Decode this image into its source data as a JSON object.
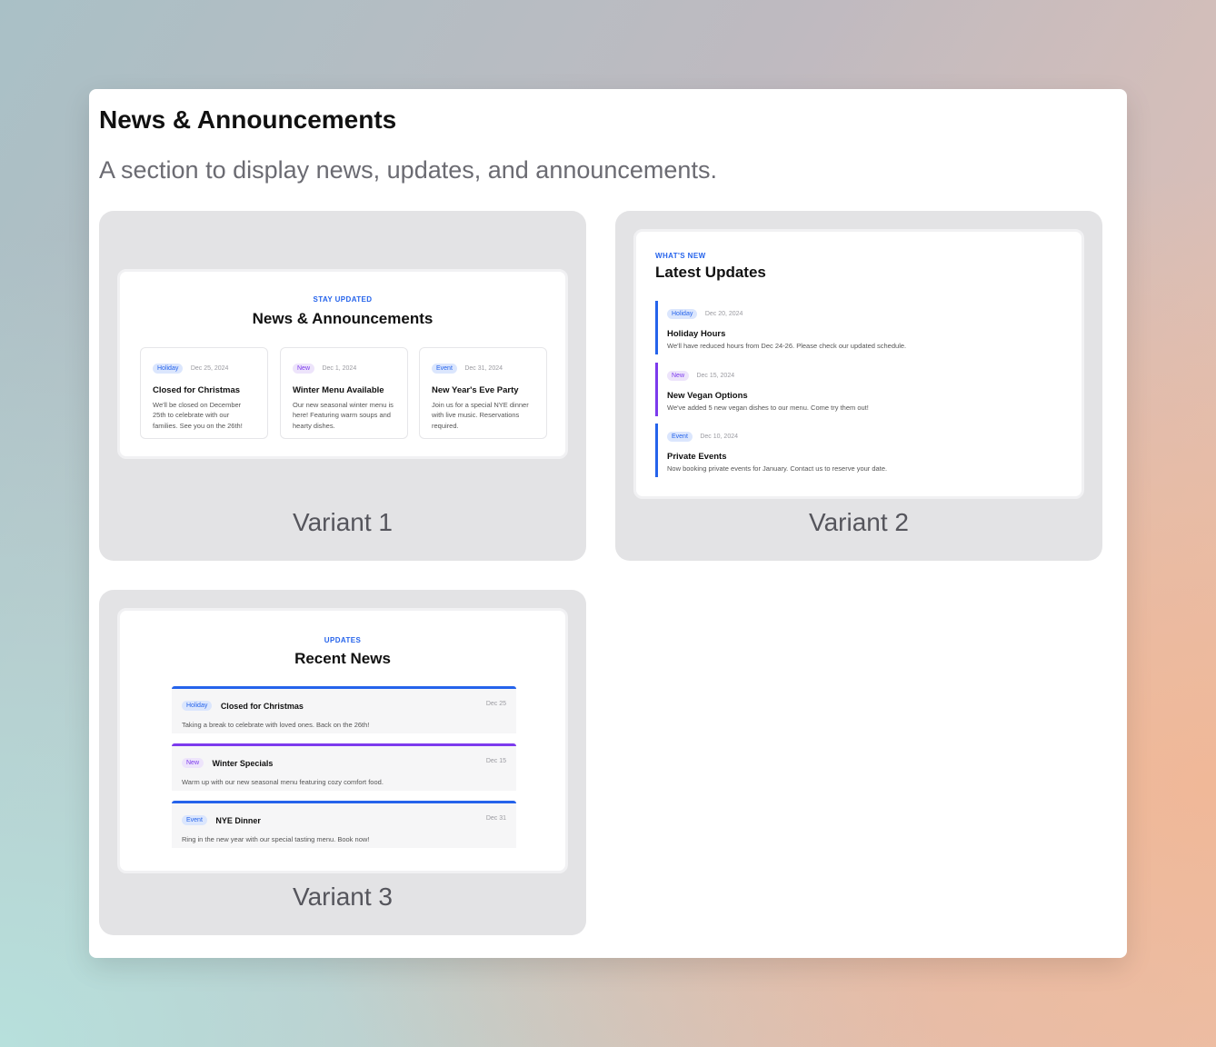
{
  "header": {
    "title": "News & Announcements",
    "description": "A section to display news, updates, and announcements."
  },
  "variants": [
    {
      "label": "Variant 1",
      "eyebrow": "STAY UPDATED",
      "title": "News & Announcements",
      "items": [
        {
          "badge": "Holiday",
          "date": "Dec 25, 2024",
          "title": "Closed for Christmas",
          "text": "We'll be closed on December 25th to celebrate with our families. See you on the 26th!"
        },
        {
          "badge": "New",
          "date": "Dec 1, 2024",
          "title": "Winter Menu Available",
          "text": "Our new seasonal winter menu is here! Featuring warm soups and hearty dishes."
        },
        {
          "badge": "Event",
          "date": "Dec 31, 2024",
          "title": "New Year's Eve Party",
          "text": "Join us for a special NYE dinner with live music. Reservations required."
        }
      ]
    },
    {
      "label": "Variant 2",
      "eyebrow": "WHAT'S NEW",
      "title": "Latest Updates",
      "items": [
        {
          "badge": "Holiday",
          "date": "Dec 20, 2024",
          "title": "Holiday Hours",
          "text": "We'll have reduced hours from Dec 24-26. Please check our updated schedule."
        },
        {
          "badge": "New",
          "date": "Dec 15, 2024",
          "title": "New Vegan Options",
          "text": "We've added 5 new vegan dishes to our menu. Come try them out!"
        },
        {
          "badge": "Event",
          "date": "Dec 10, 2024",
          "title": "Private Events",
          "text": "Now booking private events for January. Contact us to reserve your date."
        }
      ]
    },
    {
      "label": "Variant 3",
      "eyebrow": "UPDATES",
      "title": "Recent News",
      "items": [
        {
          "badge": "Holiday",
          "date": "Dec 25",
          "title": "Closed for Christmas",
          "text": "Taking a break to celebrate with loved ones. Back on the 26th!"
        },
        {
          "badge": "New",
          "date": "Dec 15",
          "title": "Winter Specials",
          "text": "Warm up with our new seasonal menu featuring cozy comfort food."
        },
        {
          "badge": "Event",
          "date": "Dec 31",
          "title": "NYE Dinner",
          "text": "Ring in the new year with our special tasting menu. Book now!"
        }
      ]
    }
  ],
  "colors": {
    "accent_blue": "#2563eb",
    "accent_purple": "#7c3aed"
  }
}
